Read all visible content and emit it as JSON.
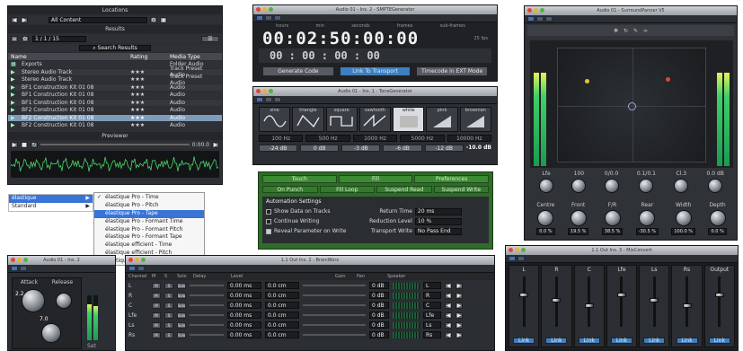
{
  "locations": {
    "title": "Locations",
    "select": "All Content"
  },
  "results": {
    "title": "Results",
    "count": "1 / 1 / 15",
    "search": "Search Results",
    "headers": [
      "Name",
      "Rating",
      "Media Type"
    ],
    "rows": [
      [
        "Exports",
        "",
        "Folder Audio"
      ],
      [
        "Stereo Audio Track",
        "★★★",
        "Track Preset Audio"
      ],
      [
        "Stereo Audio Track",
        "★★★",
        "Track Preset Audio"
      ],
      [
        "BF1 Construction Kit 01 08",
        "★★★",
        "Audio"
      ],
      [
        "BF1 Construction Kit 01 08",
        "★★★",
        "Audio"
      ],
      [
        "BF1 Construction Kit 01 08",
        "★★★",
        "Audio"
      ],
      [
        "BF2 Construction Kit 01 08",
        "★★★",
        "Audio"
      ],
      [
        "BF2 Construction Kit 01 08",
        "★★★",
        "Audio"
      ],
      [
        "BF2 Construction Kit 01 08",
        "★★★",
        "Audio"
      ]
    ]
  },
  "previewer": {
    "title": "Previewer",
    "time": "0:00.0",
    "end": "00"
  },
  "algo": {
    "left": [
      {
        "label": "élastique",
        "arrow": "▶"
      },
      {
        "label": "Standard",
        "arrow": "▶"
      }
    ],
    "options": [
      "élastique Pro - Time",
      "élastique Pro - Pitch",
      "élastique Pro - Tape",
      "élastique Pro - Formant Time",
      "élastique Pro - Formant Pitch",
      "élastique Pro - Formant Tape",
      "élastique efficient - Time",
      "élastique efficient - Pitch",
      "élastique efficient - Tape"
    ],
    "selected": 2,
    "check": "✓"
  },
  "smpte": {
    "title": "Audio 01 - Ins. 2 - SMPTEGenerator",
    "heads": [
      "hours",
      "min",
      "seconds",
      "frames",
      "sub-frames"
    ],
    "fps": "25 fps",
    "time": "00:02:50:00:00",
    "blank": "00 : 00 : 00 : 00",
    "buttons": [
      "Generate Code",
      "Link To Transport",
      "Timecode in EXT Mode"
    ]
  },
  "tone": {
    "title": "Audio 01 - Ins. 1 - ToneGenerator",
    "shapes": [
      "sine",
      "triangle",
      "square",
      "sawtooth",
      "white",
      "pink",
      "brownian"
    ],
    "freqs": [
      "100 Hz",
      "500 Hz",
      "1000 Hz",
      "5000 Hz",
      "10000 Hz"
    ],
    "db": [
      "-24 dB",
      "0 dB",
      "-3 dB",
      "-6 dB",
      "-12 dB"
    ],
    "lvl": "-10.0 dB"
  },
  "auto": {
    "title": "Automation",
    "tabs": [
      "Touch",
      "Fill",
      "Preferences"
    ],
    "sub": [
      "On Punch",
      "Fill Loop",
      "Suspend Read",
      "Suspend Write"
    ],
    "heading": "Automation Settings",
    "checks": [
      "Show Data on Tracks",
      "Continue Writing",
      "Reveal Parameter on Write"
    ],
    "fields": [
      {
        "label": "Return Time",
        "value": "20 ms"
      },
      {
        "label": "Reduction Level",
        "value": "10 %"
      },
      {
        "label": "Transport Write",
        "value": "No Pass End"
      }
    ]
  },
  "surround": {
    "title": "Audio 01 - SurroundPanner V5",
    "knob_labels": [
      "Lfe",
      "100",
      "0/0.0",
      "0.1/0.1",
      "Cl.3",
      "0.0 dB"
    ],
    "controls": [
      "Centre",
      "Front",
      "F/R",
      "Rear",
      "Width",
      "Depth"
    ],
    "values": [
      "0.0 %",
      "19.5 %",
      "38.5 %",
      "-30.5 %",
      "100.0 %",
      "0.0 %"
    ]
  },
  "ins2": {
    "title": "Audio 01 - Ins. 2",
    "labels": [
      "Attack",
      "Release"
    ],
    "value1": "2.2",
    "value2": "7.0",
    "bottom": "Sat"
  },
  "eq": {
    "title": "1.1 Out Ins. 2 - BrainWorx",
    "headers": [
      "Channel",
      "M",
      "S",
      "Solo",
      "Delay",
      "Level",
      "",
      "Gain",
      "Pan",
      "Speaker"
    ],
    "rows": [
      {
        "ch": "L",
        "delay": "0.00 ms",
        "dist": "0.0 cm",
        "gain": "0 dB",
        "spk": "L"
      },
      {
        "ch": "R",
        "delay": "0.00 ms",
        "dist": "0.0 cm",
        "gain": "0 dB",
        "spk": "R"
      },
      {
        "ch": "C",
        "delay": "0.00 ms",
        "dist": "0.0 cm",
        "gain": "0 dB",
        "spk": "C"
      },
      {
        "ch": "Lfe",
        "delay": "0.00 ms",
        "dist": "0.0 cm",
        "gain": "0 dB",
        "spk": "Lfe"
      },
      {
        "ch": "Ls",
        "delay": "0.00 ms",
        "dist": "0.0 cm",
        "gain": "0 dB",
        "spk": "Ls"
      },
      {
        "ch": "Rs",
        "delay": "0.00 ms",
        "dist": "0.0 cm",
        "gain": "0 dB",
        "spk": "Rs"
      }
    ]
  },
  "mixer": {
    "title": "1.1 Out Ins. 3 - MixConvert",
    "cols": [
      "L",
      "R",
      "C",
      "Lfe",
      "Ls",
      "Rs",
      "Output"
    ],
    "foot": "Link"
  }
}
